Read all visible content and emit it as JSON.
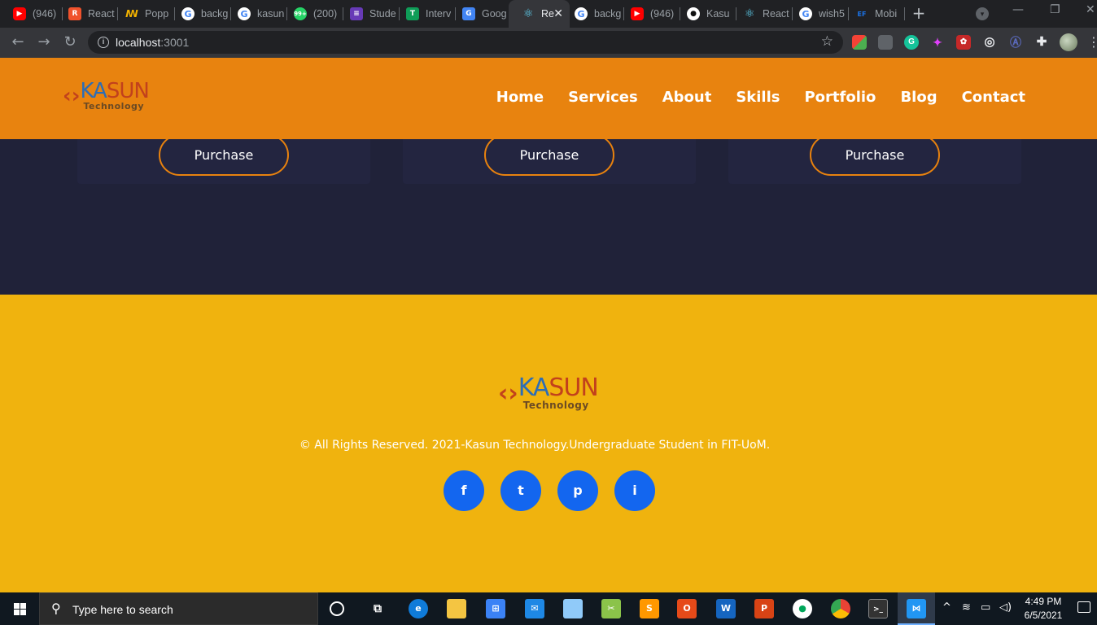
{
  "browser": {
    "tabs": [
      {
        "title": "(946)",
        "icon": "youtube-icon"
      },
      {
        "title": "React",
        "icon": "react-logo-icon"
      },
      {
        "title": "Popp",
        "icon": "poppins-icon"
      },
      {
        "title": "backg",
        "icon": "google-icon"
      },
      {
        "title": "kasun",
        "icon": "google-icon"
      },
      {
        "title": "(200)",
        "icon": "whatsapp-icon"
      },
      {
        "title": "Stude",
        "icon": "list-icon"
      },
      {
        "title": "Interv",
        "icon": "sheets-icon"
      },
      {
        "title": "Goog",
        "icon": "google-translate-icon"
      },
      {
        "title": "Re",
        "icon": "react-icon",
        "active": true
      },
      {
        "title": "backg",
        "icon": "google-icon"
      },
      {
        "title": "(946)",
        "icon": "youtube-icon"
      },
      {
        "title": "Kasu",
        "icon": "github-icon"
      },
      {
        "title": "React",
        "icon": "react-icon"
      },
      {
        "title": "wish5",
        "icon": "google-icon"
      },
      {
        "title": "Mobi",
        "icon": "ef-icon"
      }
    ],
    "url_host": "localhost",
    "url_port": ":3001"
  },
  "site": {
    "logo_main_ka": "KA",
    "logo_main_sun": "SUN",
    "logo_sub": "Technology",
    "nav": [
      "Home",
      "Services",
      "About",
      "Skills",
      "Portfolio",
      "Blog",
      "Contact"
    ],
    "purchase_label": "Purchase",
    "copyright": "© All Rights Reserved. 2021-Kasun Technology.Undergraduate Student in FIT-UoM.",
    "social": [
      "f",
      "t",
      "p",
      "i"
    ],
    "colors": {
      "header": "#e8830f",
      "dark_section": "#202239",
      "footer": "#f0b30e",
      "social": "#1366ef",
      "button_border": "#e8820e"
    }
  },
  "taskbar": {
    "search_placeholder": "Type here to search",
    "time": "4:49 PM",
    "date": "6/5/2021"
  }
}
